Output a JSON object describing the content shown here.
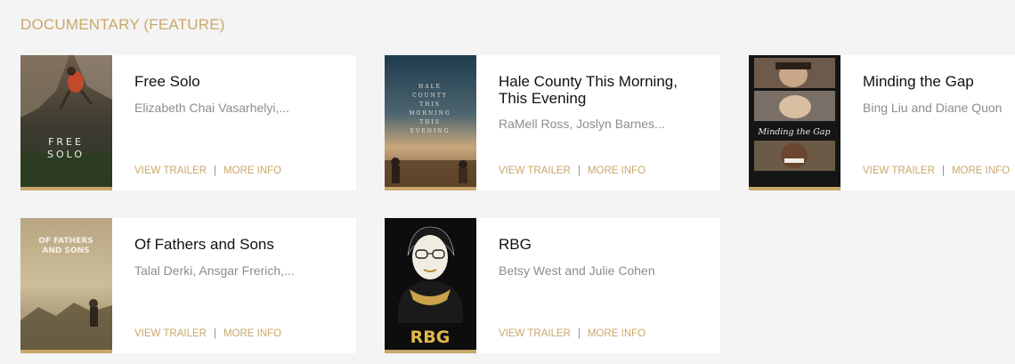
{
  "section": {
    "title": "DOCUMENTARY (FEATURE)"
  },
  "films": [
    {
      "title": "Free Solo",
      "credits": "Elizabeth Chai Vasarhelyi,...",
      "trailer": "VIEW TRAILER",
      "more": "MORE INFO",
      "poster_text": [
        "FREE",
        "SOLO"
      ]
    },
    {
      "title": "Hale County This Morning, This Evening",
      "credits": "RaMell Ross, Joslyn Barnes...",
      "trailer": "VIEW TRAILER",
      "more": "MORE INFO",
      "poster_text": [
        "HALE",
        "COUNTY",
        "THIS",
        "MORNING",
        "THIS",
        "EVENING"
      ]
    },
    {
      "title": "Minding the Gap",
      "credits": "Bing Liu and Diane Quon",
      "trailer": "VIEW TRAILER",
      "more": "MORE INFO",
      "poster_text": [
        "Minding the Gap"
      ]
    },
    {
      "title": "Of Fathers and Sons",
      "credits": "Talal Derki, Ansgar Frerich,...",
      "trailer": "VIEW TRAILER",
      "more": "MORE INFO",
      "poster_text": [
        "OF FATHERS",
        "AND SONS"
      ]
    },
    {
      "title": "RBG",
      "credits": "Betsy West and Julie Cohen",
      "trailer": "VIEW TRAILER",
      "more": "MORE INFO",
      "poster_text": [
        "RBG"
      ]
    }
  ],
  "colors": {
    "accent": "#c9a76a",
    "background": "#f4f4f4",
    "card": "#ffffff",
    "credits": "#8d8d8d"
  }
}
